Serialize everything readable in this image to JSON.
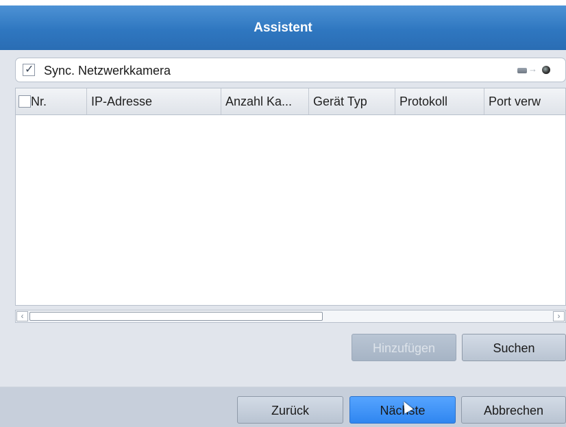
{
  "dialog": {
    "title": "Assistent"
  },
  "sync": {
    "label": "Sync. Netzwerkkamera",
    "checked": true,
    "icons": [
      "hdd-icon",
      "arrow-right-icon",
      "camera-icon"
    ]
  },
  "table": {
    "columns": [
      "Nr.",
      "IP-Adresse",
      "Anzahl Ka...",
      "Gerät Typ",
      "Protokoll",
      "Port verw"
    ],
    "rows": []
  },
  "actions": {
    "add_label": "Hinzufügen",
    "search_label": "Suchen"
  },
  "footer": {
    "back_label": "Zurück",
    "next_label": "Nächste",
    "cancel_label": "Abbrechen"
  },
  "colors": {
    "title_bar": "#2f77c0",
    "primary_button": "#3a8ef5",
    "panel": "#e1e5ec"
  }
}
